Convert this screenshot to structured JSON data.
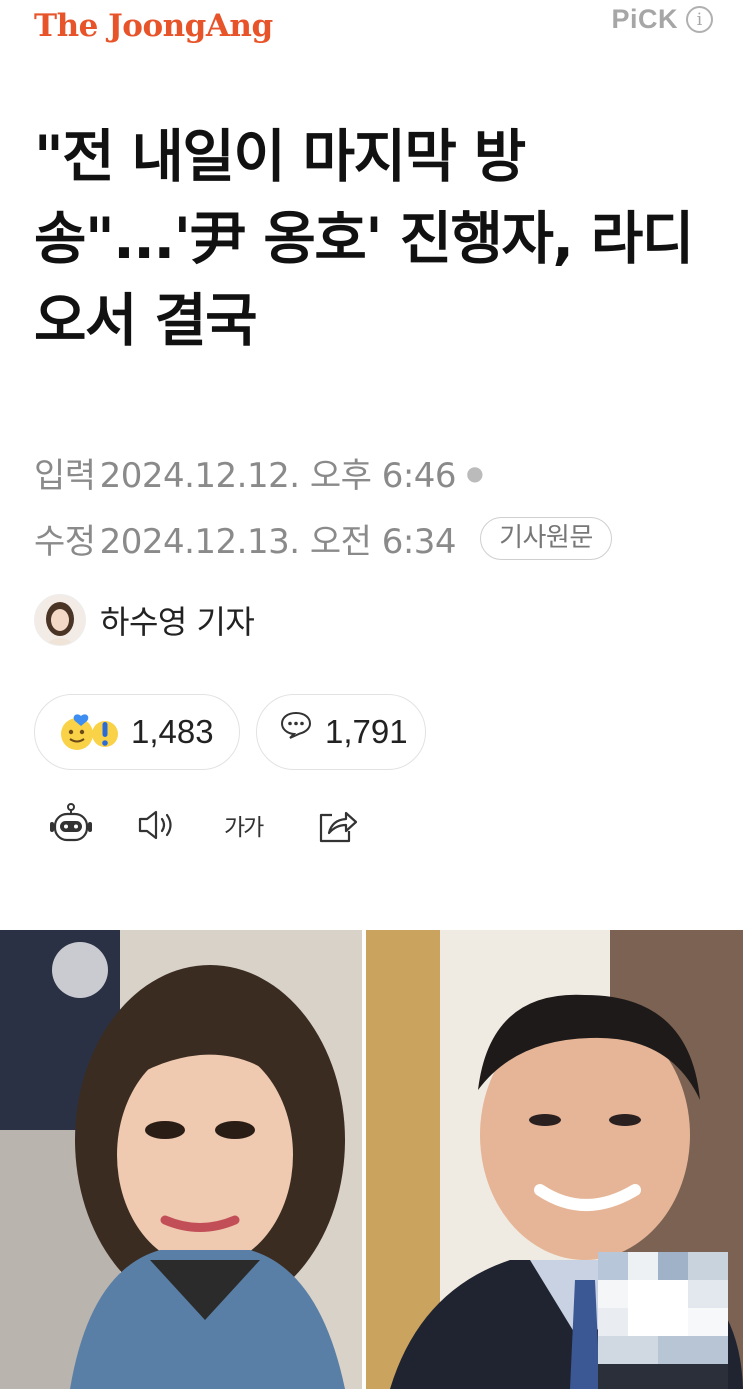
{
  "header": {
    "logo": "The JoongAng",
    "pick_label": "PiCK",
    "info_icon": "info-icon",
    "logo_color": "#e8542a"
  },
  "article": {
    "headline": "\"전 내일이 마지막 방송\"...'尹 옹호' 진행자, 라디오서 결국",
    "published_label": "입력",
    "published_value": "2024.12.12. 오후 6:46",
    "modified_label": "수정",
    "modified_value": "2024.12.13. 오전 6:34",
    "original_button": "기사원문",
    "reporter": "하수영 기자"
  },
  "reactions": {
    "emoji_count": "1,483",
    "comment_count": "1,791",
    "emoji_icon": "reaction-emoji-icon",
    "comment_icon": "comment-bubble-icon"
  },
  "toolbar": {
    "summary_icon": "robot-summary-icon",
    "tts_icon": "speaker-icon",
    "font_size_label": "가가",
    "share_icon": "share-icon"
  },
  "photo": {
    "description_icon": "article-photo"
  }
}
